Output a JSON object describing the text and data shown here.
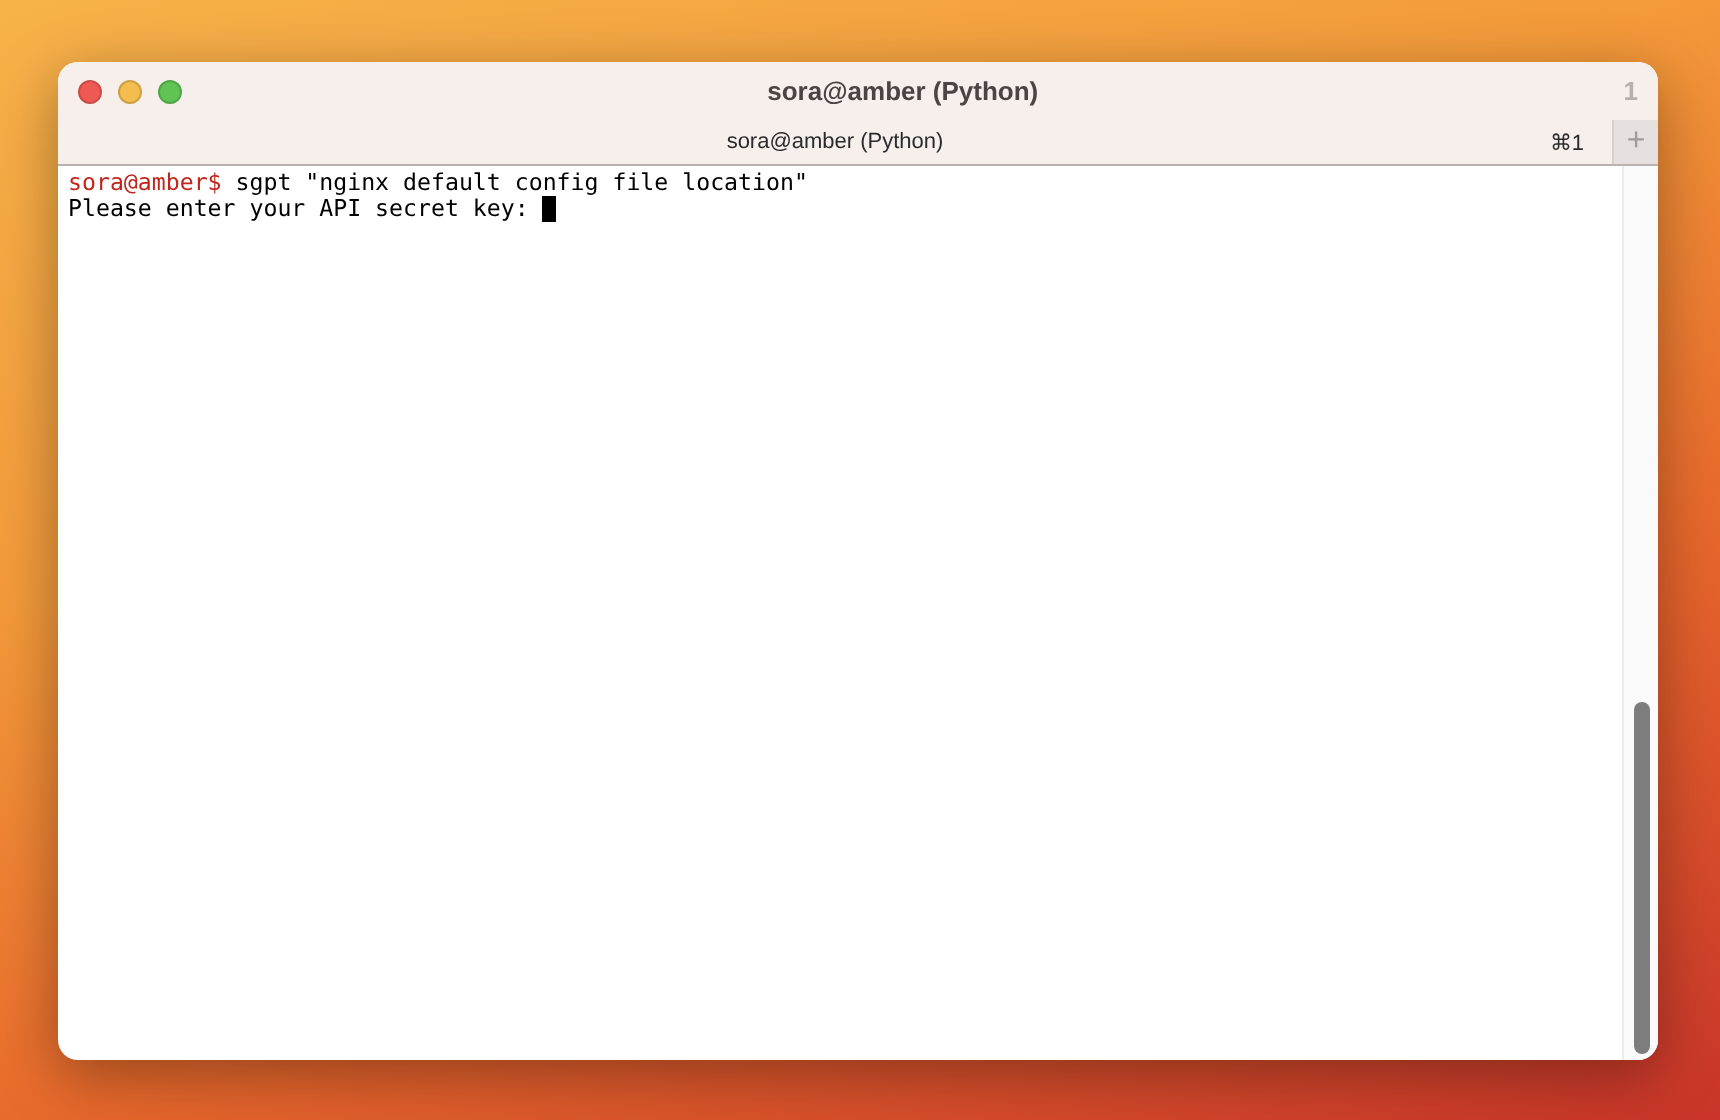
{
  "window": {
    "title": "sora@amber (Python)",
    "window_number": "1"
  },
  "tabs": [
    {
      "label": "sora@amber (Python)",
      "shortcut": "⌘1",
      "selected": true
    }
  ],
  "new_tab_button": "+",
  "terminal": {
    "lines": [
      {
        "kind": "command",
        "prompt": "sora@amber$",
        "text": "sgpt \"nginx default config file location\""
      },
      {
        "kind": "output",
        "text": "Please enter your API secret key: ",
        "cursor": true
      }
    ]
  }
}
